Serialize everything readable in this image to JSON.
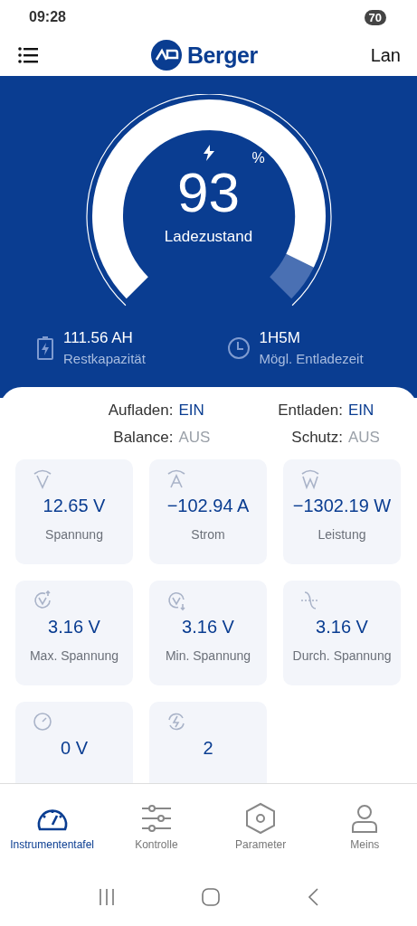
{
  "status_bar": {
    "time": "09:28",
    "battery": "70"
  },
  "header": {
    "brand": "Berger",
    "language": "Lan"
  },
  "gauge": {
    "value": "93",
    "unit": "%",
    "label": "Ladezustand"
  },
  "summary": [
    {
      "kind": "battery",
      "value": "111.56 AH",
      "label": "Restkapazität"
    },
    {
      "kind": "clock",
      "value": "1H5M",
      "label": "Mögl. Entladezeit"
    }
  ],
  "switches": [
    {
      "label": "Aufladen:",
      "state": "EIN",
      "on": true
    },
    {
      "label": "Entladen:",
      "state": "EIN",
      "on": true
    },
    {
      "label": "Balance:",
      "state": "AUS",
      "on": false
    },
    {
      "label": "Schutz:",
      "state": "AUS",
      "on": false
    }
  ],
  "cards": [
    {
      "kind": "volt",
      "value": "12.65 V",
      "label": "Spannung"
    },
    {
      "kind": "amp",
      "value": "−102.94 A",
      "label": "Strom"
    },
    {
      "kind": "watt",
      "value": "−1302.19 W",
      "label": "Leistung"
    },
    {
      "kind": "vmax",
      "value": "3.16 V",
      "label": "Max. Spannung"
    },
    {
      "kind": "vmin",
      "value": "3.16 V",
      "label": "Min. Spannung"
    },
    {
      "kind": "vavg",
      "value": "3.16 V",
      "label": "Durch. Spannung"
    },
    {
      "kind": "gauge",
      "value": "0 V"
    },
    {
      "kind": "cycle",
      "value": "2"
    }
  ],
  "tabs": [
    {
      "kind": "dashboard",
      "label": "Instrumententafel",
      "selected": true
    },
    {
      "kind": "sliders",
      "label": "Kontrolle",
      "selected": false
    },
    {
      "kind": "hexagon",
      "label": "Parameter",
      "selected": false
    },
    {
      "kind": "person",
      "label": "Meins",
      "selected": false
    }
  ]
}
